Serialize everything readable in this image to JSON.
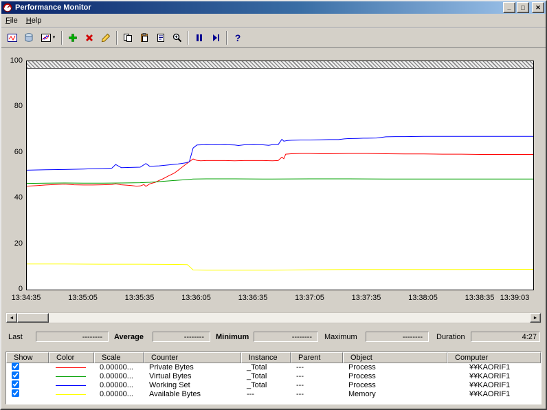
{
  "window": {
    "title": "Performance Monitor",
    "minimize": "_",
    "maximize": "□",
    "close": "✕"
  },
  "menu": {
    "items": [
      {
        "label": "File"
      },
      {
        "label": "Help"
      }
    ]
  },
  "toolbar": {
    "dropdown_glyph": "▼",
    "help_glyph": "?"
  },
  "scrollbar": {
    "left_glyph": "◄",
    "right_glyph": "►"
  },
  "stats": {
    "last": {
      "label": "Last",
      "value": "--------"
    },
    "average": {
      "label": "Average",
      "value": "--------"
    },
    "minimum": {
      "label": "Minimum",
      "value": "--------"
    },
    "maximum": {
      "label": "Maximum",
      "value": "--------"
    },
    "duration": {
      "label": "Duration",
      "value": "4:27"
    }
  },
  "legend": {
    "headers": [
      "Show",
      "Color",
      "Scale",
      "Counter",
      "Instance",
      "Parent",
      "Object",
      "Computer"
    ],
    "rows": [
      {
        "show": true,
        "color": "#ff0000",
        "scale": "0.00000...",
        "counter": "Private Bytes",
        "instance": "_Total",
        "parent": "---",
        "object": "Process",
        "computer": "¥¥KAORIF1"
      },
      {
        "show": true,
        "color": "#00a000",
        "scale": "0.00000...",
        "counter": "Virtual Bytes",
        "instance": "_Total",
        "parent": "---",
        "object": "Process",
        "computer": "¥¥KAORIF1"
      },
      {
        "show": true,
        "color": "#0000ff",
        "scale": "0.00000...",
        "counter": "Working Set",
        "instance": "_Total",
        "parent": "---",
        "object": "Process",
        "computer": "¥¥KAORIF1"
      },
      {
        "show": true,
        "color": "#ffff00",
        "scale": "0.00000...",
        "counter": "Available Bytes",
        "instance": "---",
        "parent": "---",
        "object": "Memory",
        "computer": "¥¥KAORIF1"
      }
    ]
  },
  "chart_data": {
    "type": "line",
    "title": "",
    "xlabel": "",
    "ylabel": "",
    "ylim": [
      0,
      100
    ],
    "grid": false,
    "legend_position": "bottom-table",
    "y_ticks": [
      0,
      20,
      40,
      60,
      80,
      100
    ],
    "x_range_seconds": [
      0,
      268
    ],
    "x_ticks": [
      {
        "label": "13:34:35",
        "t": 0
      },
      {
        "label": "13:35:05",
        "t": 30
      },
      {
        "label": "13:35:35",
        "t": 60
      },
      {
        "label": "13:36:05",
        "t": 90
      },
      {
        "label": "13:36:35",
        "t": 120
      },
      {
        "label": "13:37:05",
        "t": 150
      },
      {
        "label": "13:37:35",
        "t": 180
      },
      {
        "label": "13:38:05",
        "t": 210
      },
      {
        "label": "13:38:35",
        "t": 240
      },
      {
        "label": "13:39:03",
        "t": 268
      }
    ],
    "series": [
      {
        "name": "Private Bytes",
        "color": "#ff0000",
        "points": [
          [
            0,
            45.3
          ],
          [
            5,
            45.5
          ],
          [
            10,
            45.8
          ],
          [
            15,
            46.0
          ],
          [
            20,
            46.2
          ],
          [
            25,
            45.9
          ],
          [
            30,
            45.8
          ],
          [
            35,
            45.8
          ],
          [
            40,
            45.9
          ],
          [
            45,
            46.0
          ],
          [
            47,
            46.3
          ],
          [
            50,
            45.9
          ],
          [
            55,
            45.6
          ],
          [
            58,
            45.3
          ],
          [
            60,
            45.4
          ],
          [
            62,
            46.0
          ],
          [
            63,
            45.2
          ],
          [
            65,
            46.3
          ],
          [
            68,
            47.0
          ],
          [
            70,
            47.8
          ],
          [
            72,
            48.5
          ],
          [
            75,
            49.8
          ],
          [
            78,
            51.0
          ],
          [
            80,
            52.2
          ],
          [
            82,
            53.5
          ],
          [
            84,
            54.8
          ],
          [
            86,
            56.0
          ],
          [
            88,
            57.2
          ],
          [
            90,
            56.6
          ],
          [
            92,
            56.4
          ],
          [
            95,
            56.5
          ],
          [
            100,
            56.5
          ],
          [
            105,
            56.5
          ],
          [
            110,
            56.4
          ],
          [
            115,
            56.5
          ],
          [
            120,
            56.5
          ],
          [
            125,
            56.5
          ],
          [
            130,
            56.4
          ],
          [
            133,
            56.5
          ],
          [
            135,
            58.0
          ],
          [
            136,
            57.3
          ],
          [
            137,
            59.3
          ],
          [
            140,
            59.5
          ],
          [
            145,
            59.6
          ],
          [
            150,
            59.6
          ],
          [
            155,
            59.5
          ],
          [
            160,
            59.5
          ],
          [
            170,
            59.6
          ],
          [
            180,
            59.6
          ],
          [
            190,
            59.5
          ],
          [
            200,
            59.4
          ],
          [
            210,
            59.4
          ],
          [
            220,
            59.3
          ],
          [
            230,
            59.3
          ],
          [
            240,
            59.2
          ],
          [
            250,
            59.2
          ],
          [
            260,
            59.2
          ],
          [
            268,
            59.2
          ]
        ]
      },
      {
        "name": "Virtual Bytes",
        "color": "#00a000",
        "points": [
          [
            0,
            46.5
          ],
          [
            10,
            46.6
          ],
          [
            20,
            46.7
          ],
          [
            30,
            46.6
          ],
          [
            40,
            46.6
          ],
          [
            50,
            46.7
          ],
          [
            60,
            46.8
          ],
          [
            65,
            47.0
          ],
          [
            70,
            47.3
          ],
          [
            75,
            47.6
          ],
          [
            80,
            47.9
          ],
          [
            85,
            48.2
          ],
          [
            88,
            48.4
          ],
          [
            95,
            48.5
          ],
          [
            110,
            48.5
          ],
          [
            130,
            48.4
          ],
          [
            150,
            48.5
          ],
          [
            170,
            48.5
          ],
          [
            190,
            48.4
          ],
          [
            210,
            48.4
          ],
          [
            230,
            48.4
          ],
          [
            250,
            48.4
          ],
          [
            268,
            48.4
          ]
        ]
      },
      {
        "name": "Working Set",
        "color": "#0000ff",
        "points": [
          [
            0,
            52.3
          ],
          [
            10,
            52.5
          ],
          [
            20,
            52.6
          ],
          [
            30,
            52.8
          ],
          [
            40,
            53.0
          ],
          [
            45,
            53.2
          ],
          [
            47,
            54.8
          ],
          [
            50,
            53.4
          ],
          [
            55,
            53.5
          ],
          [
            60,
            53.6
          ],
          [
            63,
            55.2
          ],
          [
            65,
            54.0
          ],
          [
            70,
            54.2
          ],
          [
            75,
            54.6
          ],
          [
            80,
            55.0
          ],
          [
            84,
            55.5
          ],
          [
            86,
            56.0
          ],
          [
            88,
            62.0
          ],
          [
            90,
            63.3
          ],
          [
            95,
            63.5
          ],
          [
            100,
            63.4
          ],
          [
            105,
            63.5
          ],
          [
            110,
            63.3
          ],
          [
            112,
            63.1
          ],
          [
            115,
            63.4
          ],
          [
            120,
            63.5
          ],
          [
            125,
            63.4
          ],
          [
            128,
            63.2
          ],
          [
            130,
            63.5
          ],
          [
            133,
            63.5
          ],
          [
            135,
            65.8
          ],
          [
            136,
            65.0
          ],
          [
            138,
            65.3
          ],
          [
            140,
            65.4
          ],
          [
            145,
            65.5
          ],
          [
            150,
            65.5
          ],
          [
            155,
            65.6
          ],
          [
            160,
            65.7
          ],
          [
            165,
            65.7
          ],
          [
            168,
            66.0
          ],
          [
            170,
            66.1
          ],
          [
            175,
            66.2
          ],
          [
            178,
            66.3
          ],
          [
            180,
            66.3
          ],
          [
            185,
            66.4
          ],
          [
            190,
            66.9
          ],
          [
            195,
            67.0
          ],
          [
            200,
            67.0
          ],
          [
            210,
            67.1
          ],
          [
            220,
            67.1
          ],
          [
            230,
            67.1
          ],
          [
            240,
            67.1
          ],
          [
            250,
            67.1
          ],
          [
            260,
            67.1
          ],
          [
            268,
            67.1
          ]
        ]
      },
      {
        "name": "Available Bytes",
        "color": "#ffff00",
        "points": [
          [
            0,
            11.2
          ],
          [
            20,
            11.2
          ],
          [
            40,
            11.1
          ],
          [
            60,
            11.1
          ],
          [
            80,
            11.0
          ],
          [
            85,
            10.9
          ],
          [
            88,
            8.6
          ],
          [
            95,
            8.5
          ],
          [
            110,
            8.5
          ],
          [
            130,
            8.5
          ],
          [
            150,
            8.7
          ],
          [
            170,
            8.8
          ],
          [
            190,
            8.8
          ],
          [
            210,
            8.8
          ],
          [
            230,
            8.8
          ],
          [
            250,
            8.9
          ],
          [
            268,
            8.9
          ]
        ]
      }
    ]
  }
}
